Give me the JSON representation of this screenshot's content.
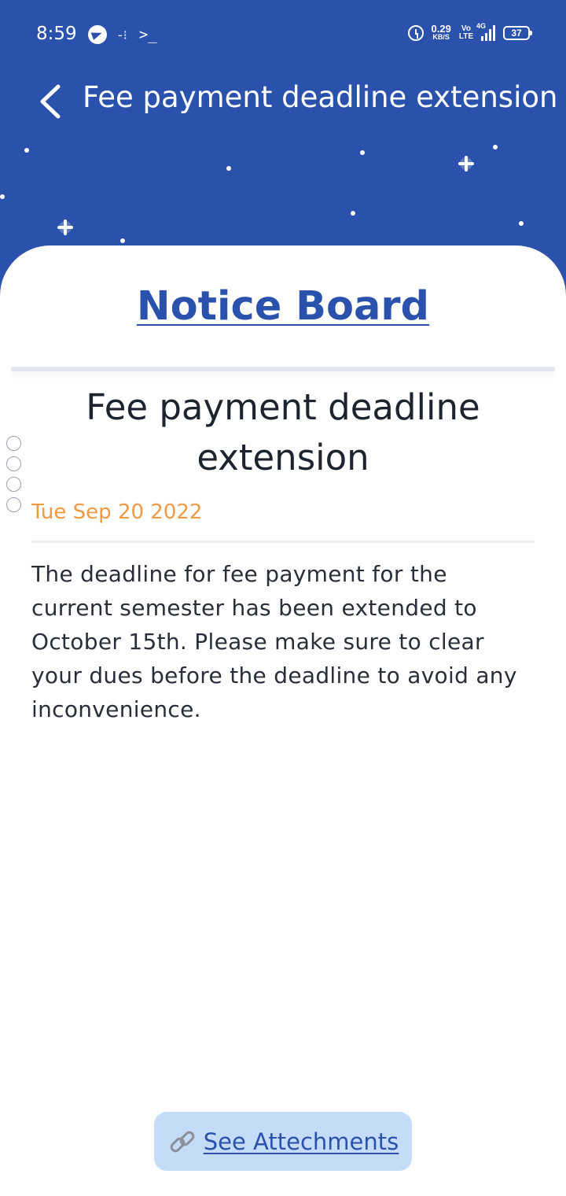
{
  "status_bar": {
    "time": "8:59",
    "net_speed_value": "0.29",
    "net_speed_unit": "KB/S",
    "volte_top": "Vo",
    "volte_bottom": "LTE",
    "network_type": "4G",
    "battery": "37"
  },
  "nav": {
    "title": "Fee payment deadline extension"
  },
  "board": {
    "title": "Notice Board"
  },
  "notice": {
    "title": "Fee payment deadline extension",
    "date": "Tue Sep 20 2022",
    "body": "The deadline for fee payment for the current semester has been extended to October 15th. Please make sure to clear your dues before the deadline to avoid any inconvenience."
  },
  "attachments": {
    "label": "See Attechments"
  },
  "colors": {
    "header_blue": "#2a52ad",
    "date_orange": "#ed9a47",
    "attach_bg": "#c5dcf8"
  }
}
